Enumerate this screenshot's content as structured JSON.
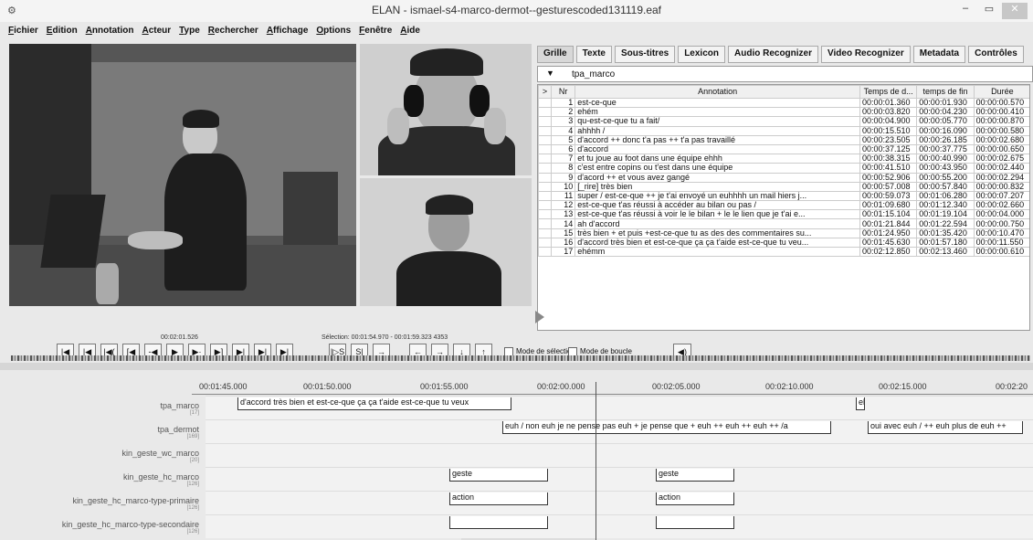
{
  "window": {
    "title": "ELAN - ismael-s4-marco-dermot--gesturescoded131119.eaf",
    "minimize": "–",
    "maximize": "▭",
    "close": "✕"
  },
  "menu": [
    "Fichier",
    "Edition",
    "Annotation",
    "Acteur",
    "Type",
    "Rechercher",
    "Affichage",
    "Options",
    "Fenêtre",
    "Aide"
  ],
  "tabs": [
    "Grille",
    "Texte",
    "Sous-titres",
    "Lexicon",
    "Audio Recognizer",
    "Video Recognizer",
    "Metadata",
    "Contrôles"
  ],
  "grid": {
    "tier": "tpa_marco",
    "headers": {
      "nr": "Nr",
      "annotation": "Annotation",
      "start": "Temps de d...",
      "end": "temps de fin",
      "duration": "Durée"
    },
    "rows": [
      {
        "nr": "1",
        "text": "est-ce-que",
        "start": "00:00:01.360",
        "end": "00:00:01.930",
        "dur": "00:00:00.570"
      },
      {
        "nr": "2",
        "text": "ehém",
        "start": "00:00:03.820",
        "end": "00:00:04.230",
        "dur": "00:00:00.410"
      },
      {
        "nr": "3",
        "text": "qu-est-ce-que tu a fait/",
        "start": "00:00:04.900",
        "end": "00:00:05.770",
        "dur": "00:00:00.870"
      },
      {
        "nr": "4",
        "text": "ahhhh /",
        "start": "00:00:15.510",
        "end": "00:00:16.090",
        "dur": "00:00:00.580"
      },
      {
        "nr": "5",
        "text": "d'accord ++ donc t'a pas ++ t'a pas travaillé",
        "start": "00:00:23.505",
        "end": "00:00:26.185",
        "dur": "00:00:02.680"
      },
      {
        "nr": "6",
        "text": "d'accord",
        "start": "00:00:37.125",
        "end": "00:00:37.775",
        "dur": "00:00:00.650"
      },
      {
        "nr": "7",
        "text": "et tu joue au foot dans une équipe ehhh",
        "start": "00:00:38.315",
        "end": "00:00:40.990",
        "dur": "00:00:02.675"
      },
      {
        "nr": "8",
        "text": "c'est entre copins ou t'est dans une équipe",
        "start": "00:00:41.510",
        "end": "00:00:43.950",
        "dur": "00:00:02.440"
      },
      {
        "nr": "9",
        "text": "d'acord ++ et vous avez gangé",
        "start": "00:00:52.906",
        "end": "00:00:55.200",
        "dur": "00:00:02.294"
      },
      {
        "nr": "10",
        "text": "[_rire] très bien",
        "start": "00:00:57.008",
        "end": "00:00:57.840",
        "dur": "00:00:00.832"
      },
      {
        "nr": "11",
        "text": "super / est-ce-que ++ je t'ai envoyé un euhhhh un mail hiers j...",
        "start": "00:00:59.073",
        "end": "00:01:06.280",
        "dur": "00:00:07.207"
      },
      {
        "nr": "12",
        "text": "est-ce-que t'as réussi à accéder au bilan ou pas /",
        "start": "00:01:09.680",
        "end": "00:01:12.340",
        "dur": "00:00:02.660"
      },
      {
        "nr": "13",
        "text": "est-ce-que t'as réussi à voir le le bilan + le le lien que je t'ai e...",
        "start": "00:01:15.104",
        "end": "00:01:19.104",
        "dur": "00:00:04.000"
      },
      {
        "nr": "14",
        "text": "ah d'accord",
        "start": "00:01:21.844",
        "end": "00:01:22.594",
        "dur": "00:00:00.750"
      },
      {
        "nr": "15",
        "text": "très bien + et puis +est-ce-que tu as des des commentaires su...",
        "start": "00:01:24.950",
        "end": "00:01:35.420",
        "dur": "00:00:10.470"
      },
      {
        "nr": "16",
        "text": "d'accord très bien et est-ce-que ça ça t'aide est-ce-que tu veu...",
        "start": "00:01:45.630",
        "end": "00:01:57.180",
        "dur": "00:00:11.550"
      },
      {
        "nr": "17",
        "text": "ehémm",
        "start": "00:02:12.850",
        "end": "00:02:13.460",
        "dur": "00:00:00.610"
      }
    ]
  },
  "player": {
    "time": "00:02:01.526",
    "selection": "Sélection: 00:01:54.970 - 00:01:59.323  4353",
    "selection_mode": "Mode de sélection",
    "loop_mode": "Mode de boucle"
  },
  "controls": [
    "|◀",
    "|◀",
    "|◀(",
    "[◀",
    "-◀",
    "▶",
    "▶·",
    "▶]",
    "▶|",
    "▶|",
    "▶|"
  ],
  "sel_controls": [
    "|▷S",
    "S|",
    "→"
  ],
  "nav_controls": [
    "←",
    "→",
    "↓",
    "↑"
  ],
  "ruler": [
    "00:01:45.000",
    "00:01:50.000",
    "00:01:55.000",
    "00:02:00.000",
    "00:02:05.000",
    "00:02:10.000",
    "00:02:15.000",
    "00:02:20"
  ],
  "tiers": [
    {
      "name": "tpa_marco",
      "count": "[17]"
    },
    {
      "name": "tpa_dermot",
      "count": "[169]"
    },
    {
      "name": "kin_geste_wc_marco",
      "count": "[20]"
    },
    {
      "name": "kin_geste_hc_marco",
      "count": "[126]"
    },
    {
      "name": "kin_geste_hc_marco-type-primaire",
      "count": "[126]"
    },
    {
      "name": "kin_geste_hc_marco-type-secondaire",
      "count": "[126]"
    }
  ],
  "annotations": {
    "marco1": "d'accord très bien et est-ce-que ça ça t'aide est-ce-que tu veux",
    "marco2": "eh",
    "dermot1": "euh / non euh je ne pense pas euh + je pense que + euh ++ euh ++ euh ++ /a",
    "dermot2": "oui avec euh / ++ euh plus de euh ++",
    "geste1": "geste",
    "geste2": "geste",
    "action1": "action",
    "action2": "action"
  }
}
